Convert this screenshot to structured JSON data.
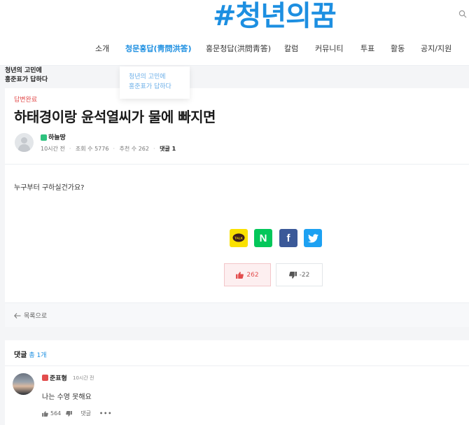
{
  "header": {
    "logo": "#청년의꿈",
    "nav": [
      {
        "label": "소개"
      },
      {
        "label": "청문홍답(靑問洪答)"
      },
      {
        "label": "홍문청답(洪問靑答)"
      },
      {
        "label": "칼럼"
      },
      {
        "label": "커뮤니티"
      },
      {
        "label": "투표"
      },
      {
        "label": "활동"
      },
      {
        "label": "공지/지원"
      }
    ],
    "dropdown": [
      {
        "label": "청년의 고민에"
      },
      {
        "label": "홍준표가 답하다"
      }
    ]
  },
  "side_note": {
    "line1": "청년의 고민에",
    "line2": "홍준표가 답하다"
  },
  "post": {
    "status": "답변완료",
    "title": "하태경이랑 윤석열씨가 물에 빠지면",
    "author": "하늘땅",
    "time": "10시간 전",
    "views": "조회 수 5776",
    "likes_meta": "추천 수 262",
    "comments_meta": "댓글 1",
    "body": "누구부터 구하실건가요?",
    "share": {
      "kakao": "TALK",
      "naver": "N",
      "facebook": "f"
    },
    "upvotes": "262",
    "downvotes": "-22",
    "back_label": "목록으로"
  },
  "comments": {
    "header": "댓글",
    "count": "총 1개",
    "items": [
      {
        "author": "준표형",
        "time": "10시간 전",
        "text": "나는 수영 못해요",
        "likes": "564",
        "reply_label": "댓글",
        "more": "•••"
      }
    ]
  },
  "colors": {
    "brand": "#1d8fe1",
    "upvote": "#e24d4d",
    "kakao": "#fae100",
    "naver": "#03c75a",
    "facebook": "#3b5998",
    "twitter": "#1da1f2"
  }
}
